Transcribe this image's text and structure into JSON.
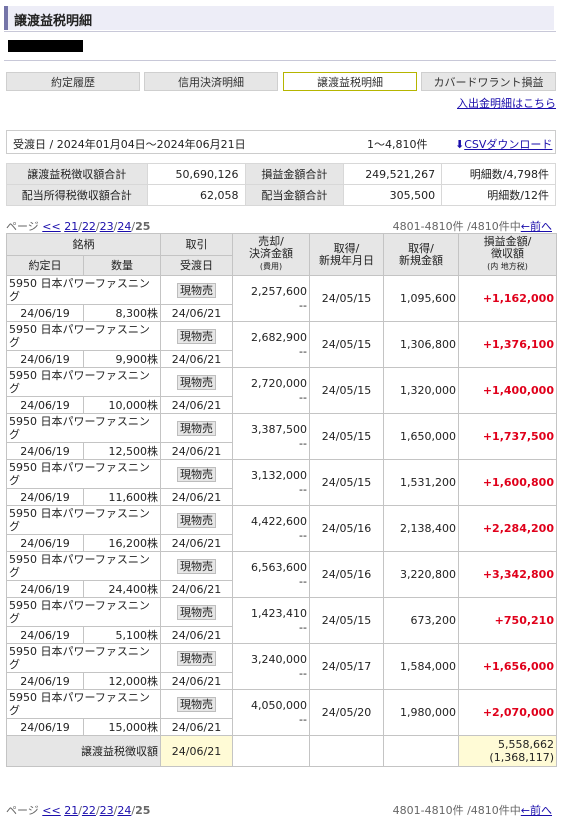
{
  "page": {
    "title": "譲渡益税明細"
  },
  "tabs": [
    "約定履歴",
    "信用決済明細",
    "譲渡益税明細",
    "カバードワラント損益"
  ],
  "active_tab": 2,
  "io_link": "入出金明細はこちら",
  "period": {
    "text": "受渡日 / 2024年01月04日〜2024年06月21日",
    "count": "1〜4,810件",
    "csv": "CSVダウンロード"
  },
  "summary": [
    {
      "l1": "譲渡益税徴収額合計",
      "v1": "50,690,126",
      "l2": "損益金額合計",
      "v2": "249,521,267",
      "cnt": "明細数/4,798件"
    },
    {
      "l1": "配当所得税徴収額合計",
      "v1": "62,058",
      "l2": "配当金額合計",
      "v2": "305,500",
      "cnt": "明細数/12件"
    }
  ],
  "pager": {
    "label": "ページ",
    "first": "<<",
    "pages": [
      "21",
      "22",
      "23",
      "24"
    ],
    "current": "25",
    "range": "4801-4810件 /4810件中",
    "prev": "←前へ"
  },
  "headers": {
    "meigara": "銘柄",
    "yakujo": "約定日",
    "suryo": "数量",
    "torihiki": "取引",
    "ukewatashi": "受渡日",
    "baikyaku1": "売却/",
    "baikyaku2": "決済金額",
    "baikyaku3": "(費用)",
    "shutoku1": "取得/",
    "shutoku2": "新規年月日",
    "shutokugaku1": "取得/",
    "shutokugaku2": "新規金額",
    "soneki1": "損益金額/",
    "soneki2": "徴収額",
    "soneki3": "(内 地方税)"
  },
  "rows": [
    {
      "name": "5950 日本パワーファスニング",
      "trade": "現物売",
      "trade_date": "24/06/19",
      "qty": "8,300株",
      "delivery": "24/06/21",
      "sale": "2,257,600",
      "fee": "--",
      "acq_date": "24/05/15",
      "acq_amount": "1,095,600",
      "pl": "+1,162,000"
    },
    {
      "name": "5950 日本パワーファスニング",
      "trade": "現物売",
      "trade_date": "24/06/19",
      "qty": "9,900株",
      "delivery": "24/06/21",
      "sale": "2,682,900",
      "fee": "--",
      "acq_date": "24/05/15",
      "acq_amount": "1,306,800",
      "pl": "+1,376,100"
    },
    {
      "name": "5950 日本パワーファスニング",
      "trade": "現物売",
      "trade_date": "24/06/19",
      "qty": "10,000株",
      "delivery": "24/06/21",
      "sale": "2,720,000",
      "fee": "--",
      "acq_date": "24/05/15",
      "acq_amount": "1,320,000",
      "pl": "+1,400,000"
    },
    {
      "name": "5950 日本パワーファスニング",
      "trade": "現物売",
      "trade_date": "24/06/19",
      "qty": "12,500株",
      "delivery": "24/06/21",
      "sale": "3,387,500",
      "fee": "--",
      "acq_date": "24/05/15",
      "acq_amount": "1,650,000",
      "pl": "+1,737,500"
    },
    {
      "name": "5950 日本パワーファスニング",
      "trade": "現物売",
      "trade_date": "24/06/19",
      "qty": "11,600株",
      "delivery": "24/06/21",
      "sale": "3,132,000",
      "fee": "--",
      "acq_date": "24/05/15",
      "acq_amount": "1,531,200",
      "pl": "+1,600,800"
    },
    {
      "name": "5950 日本パワーファスニング",
      "trade": "現物売",
      "trade_date": "24/06/19",
      "qty": "16,200株",
      "delivery": "24/06/21",
      "sale": "4,422,600",
      "fee": "--",
      "acq_date": "24/05/16",
      "acq_amount": "2,138,400",
      "pl": "+2,284,200"
    },
    {
      "name": "5950 日本パワーファスニング",
      "trade": "現物売",
      "trade_date": "24/06/19",
      "qty": "24,400株",
      "delivery": "24/06/21",
      "sale": "6,563,600",
      "fee": "--",
      "acq_date": "24/05/16",
      "acq_amount": "3,220,800",
      "pl": "+3,342,800"
    },
    {
      "name": "5950 日本パワーファスニング",
      "trade": "現物売",
      "trade_date": "24/06/19",
      "qty": "5,100株",
      "delivery": "24/06/21",
      "sale": "1,423,410",
      "fee": "--",
      "acq_date": "24/05/15",
      "acq_amount": "673,200",
      "pl": "+750,210"
    },
    {
      "name": "5950 日本パワーファスニング",
      "trade": "現物売",
      "trade_date": "24/06/19",
      "qty": "12,000株",
      "delivery": "24/06/21",
      "sale": "3,240,000",
      "fee": "--",
      "acq_date": "24/05/17",
      "acq_amount": "1,584,000",
      "pl": "+1,656,000"
    },
    {
      "name": "5950 日本パワーファスニング",
      "trade": "現物売",
      "trade_date": "24/06/19",
      "qty": "15,000株",
      "delivery": "24/06/21",
      "sale": "4,050,000",
      "fee": "--",
      "acq_date": "24/05/20",
      "acq_amount": "1,980,000",
      "pl": "+2,070,000"
    }
  ],
  "tax_row": {
    "label": "譲渡益税徴収額",
    "date": "24/06/21",
    "amount": "5,558,662",
    "local": "(1,368,117)"
  },
  "colors": {
    "gain": "#e0001b",
    "link": "#1a0dab",
    "header_bg": "#e6e6e6",
    "highlight": "#fffbd6"
  },
  "icons": {
    "csv": "download-arrow-icon"
  }
}
